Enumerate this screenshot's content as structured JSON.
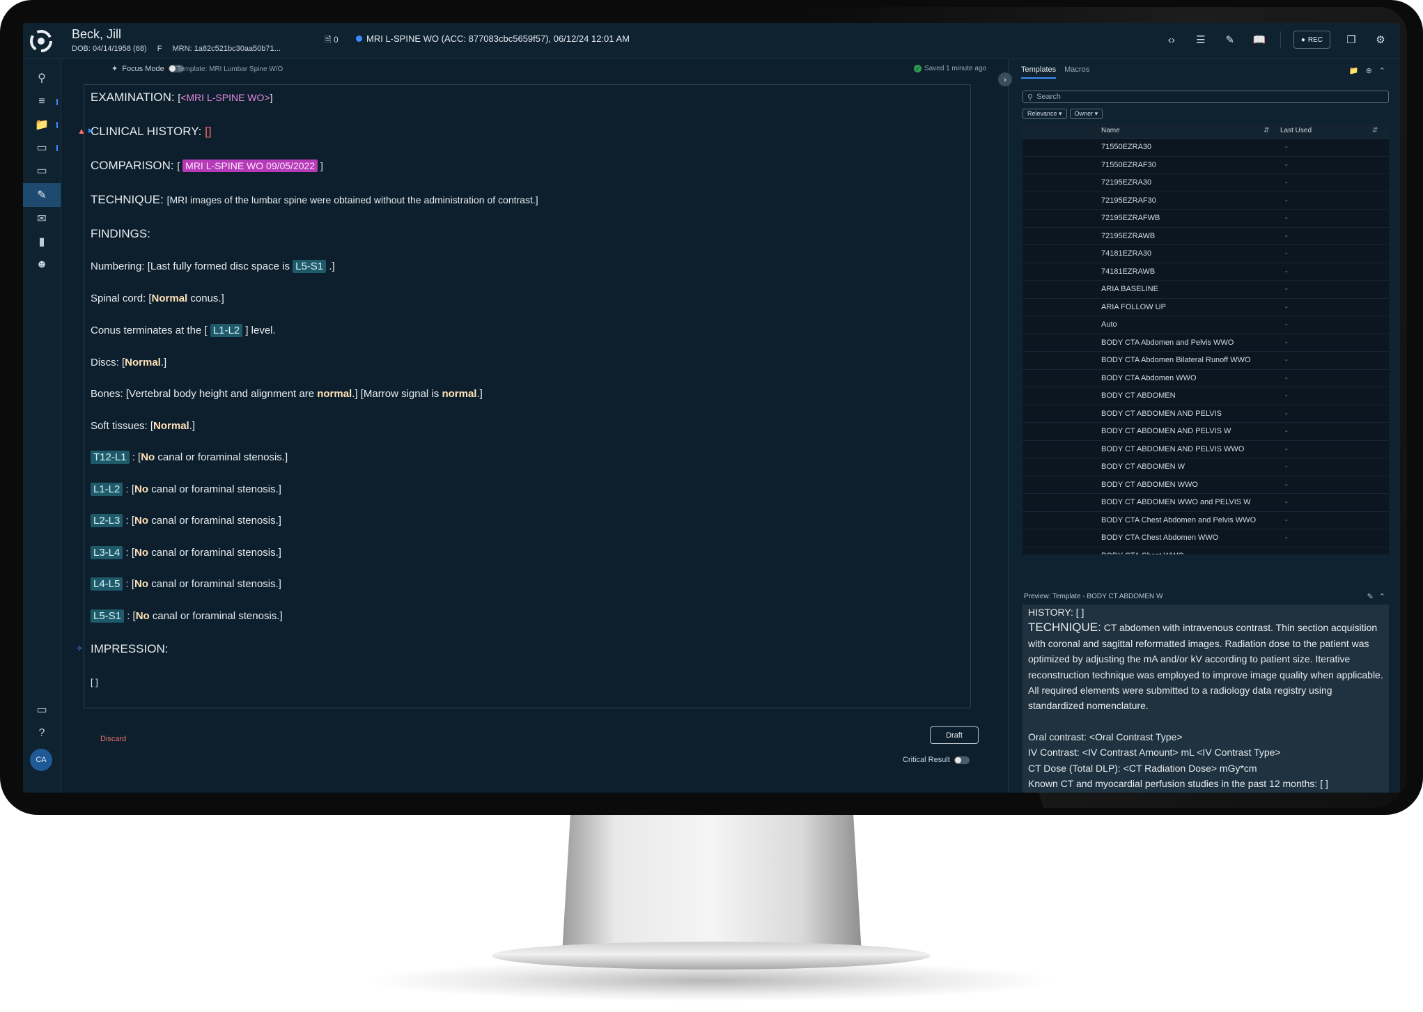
{
  "patient": {
    "name": "Beck, Jill",
    "dob": "DOB: 04/14/1958 (68)",
    "sex": "F",
    "mrn": "MRN: 1a82c521bc30aa50b71..."
  },
  "header": {
    "doc_count": "0",
    "study": "MRI L-SPINE WO (ACC: 877083cbc5659f57), 06/12/24 12:01 AM",
    "rec_label": "REC"
  },
  "editor": {
    "focus_mode_label": "Focus Mode",
    "template_label": "Template: MRI Lumbar Spine W/O",
    "saved_label": "Saved 1 minute ago",
    "discard_label": "Discard",
    "draft_label": "Draft",
    "critical_label": "Critical Result",
    "report": {
      "examination_key": "EXAMINATION:",
      "examination_val": "<MRI L-SPINE WO>",
      "clinical_key": "CLINICAL HISTORY:",
      "comparison_key": "COMPARISON:",
      "comparison_val": "MRI L-SPINE WO 09/05/2022",
      "technique_key": "TECHNIQUE:",
      "technique_val": "MRI images of the lumbar spine were obtained without the administration of contrast.",
      "findings_key": "FINDINGS:",
      "numbering_pre": "Numbering: [Last fully formed disc space is ",
      "numbering_chip": "L5-S1",
      "spinal_pre": "Spinal cord: [",
      "spinal_bold": "Normal",
      "spinal_post": " conus.]",
      "conus_pre": "Conus terminates at the [",
      "conus_chip": "L1-L2",
      "conus_post": "] level.",
      "discs_pre": "Discs: [",
      "discs_bold": "Normal",
      "bones_pre": "Bones: [Vertebral body height and alignment are ",
      "bones_bold1": "normal",
      "bones_mid": ".] [Marrow signal is ",
      "bones_bold2": "normal",
      "soft_pre": "Soft tissues: [",
      "soft_bold": "Normal",
      "levels": [
        {
          "chip": "T12-L1",
          "bold": "No",
          "text": " canal or foraminal stenosis.]"
        },
        {
          "chip": "L1-L2",
          "bold": "No",
          "text": " canal or foraminal stenosis.]"
        },
        {
          "chip": "L2-L3",
          "bold": "No",
          "text": " canal or foraminal stenosis.]"
        },
        {
          "chip": "L3-L4",
          "bold": "No",
          "text": " canal or foraminal stenosis.]"
        },
        {
          "chip": "L4-L5",
          "bold": "No",
          "text": " canal or foraminal stenosis.]"
        },
        {
          "chip": "L5-S1",
          "bold": "No",
          "text": " canal or foraminal stenosis.]"
        }
      ],
      "impression_key": "IMPRESSION:",
      "impression_val": "[ ]"
    }
  },
  "panel": {
    "tabs": [
      "Templates",
      "Macros"
    ],
    "search_placeholder": "Search",
    "filters": [
      "Relevance",
      "Owner"
    ],
    "columns": [
      "Name",
      "Last Used"
    ],
    "rows": [
      {
        "name": "71550EZRA30",
        "last": "-"
      },
      {
        "name": "71550EZRAF30",
        "last": "-"
      },
      {
        "name": "72195EZRA30",
        "last": "-"
      },
      {
        "name": "72195EZRAF30",
        "last": "-"
      },
      {
        "name": "72195EZRAFWB",
        "last": "-"
      },
      {
        "name": "72195EZRAWB",
        "last": "-"
      },
      {
        "name": "74181EZRA30",
        "last": "-"
      },
      {
        "name": "74181EZRAWB",
        "last": "-"
      },
      {
        "name": "ARIA BASELINE",
        "last": "-"
      },
      {
        "name": "ARIA FOLLOW UP",
        "last": "-"
      },
      {
        "name": "Auto",
        "last": "-"
      },
      {
        "name": "BODY CTA Abdomen and Pelvis WWO",
        "last": "-"
      },
      {
        "name": "BODY CTA Abdomen Bilateral Runoff WWO",
        "last": "-"
      },
      {
        "name": "BODY CTA Abdomen WWO",
        "last": "-"
      },
      {
        "name": "BODY CT ABDOMEN",
        "last": "-"
      },
      {
        "name": "BODY CT ABDOMEN AND PELVIS",
        "last": "-"
      },
      {
        "name": "BODY CT ABDOMEN AND PELVIS W",
        "last": "-"
      },
      {
        "name": "BODY CT ABDOMEN AND PELVIS WWO",
        "last": "-"
      },
      {
        "name": "BODY CT ABDOMEN W",
        "last": "-"
      },
      {
        "name": "BODY CT ABDOMEN WWO",
        "last": "-"
      },
      {
        "name": "BODY CT ABDOMEN WWO and PELVIS W",
        "last": "-"
      },
      {
        "name": "BODY CTA Chest Abdomen and Pelvis WWO",
        "last": "-"
      },
      {
        "name": "BODY CTA Chest Abdomen WWO",
        "last": "-"
      },
      {
        "name": "BODY CTA Chest WWO",
        "last": "-"
      }
    ],
    "preview_title": "Preview: Template - BODY CT ABDOMEN W",
    "preview": {
      "history_key": "HISTORY:",
      "history_val": "[ ]",
      "technique_key": "TECHNIQUE:",
      "technique_val": "CT abdomen with intravenous contrast. Thin section acquisition with coronal and sagittal reformatted images. Radiation dose to the patient was optimized by adjusting the mA and/or kV according to patient size. Iterative reconstruction technique was employed to improve image quality when applicable. All required elements were submitted to a radiology data registry using standardized nomenclature.",
      "oral": "Oral contrast: <Oral Contrast Type>",
      "iv": "IV Contrast: <IV Contrast Amount> mL <IV Contrast Type>",
      "dose": "CT Dose (Total DLP): <CT Radiation Dose> mGy*cm",
      "known": "Known CT and myocardial perfusion studies in the past 12 months: [ ]"
    }
  },
  "user": {
    "initials": "CA"
  }
}
